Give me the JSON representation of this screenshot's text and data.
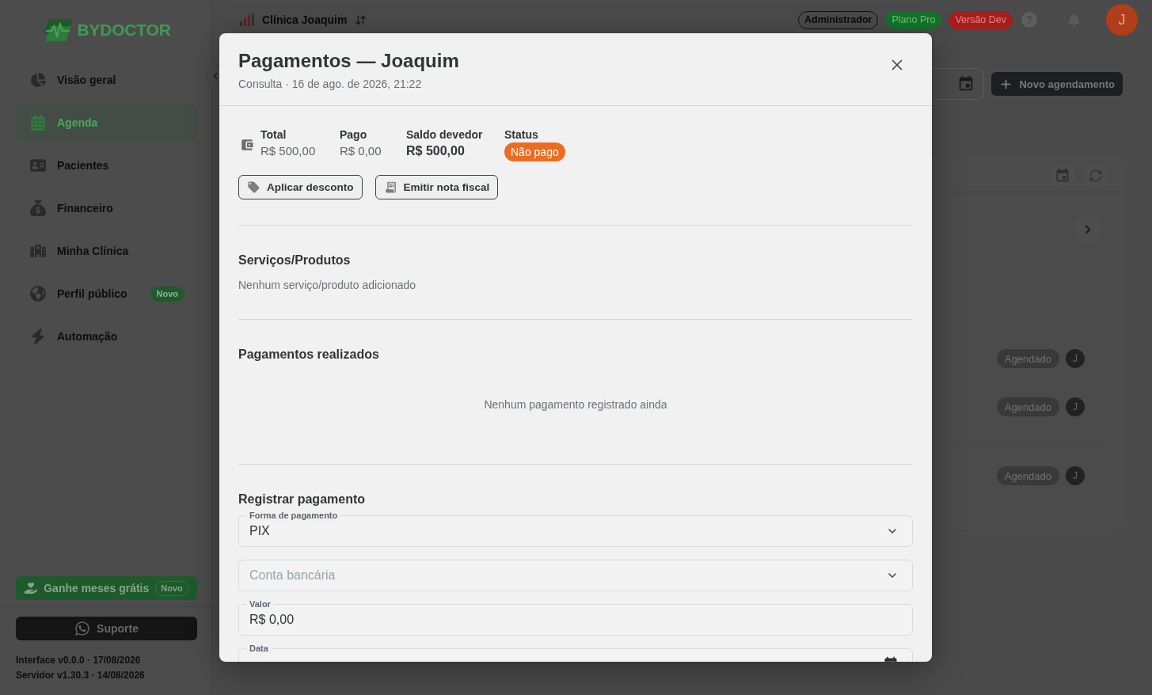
{
  "sidebar": {
    "logo": "BYDOCTOR",
    "items": [
      {
        "label": "Visão geral",
        "selected": false
      },
      {
        "label": "Agenda",
        "selected": true
      },
      {
        "label": "Pacientes",
        "selected": false
      },
      {
        "label": "Financeiro",
        "selected": false
      },
      {
        "label": "Minha Clínica",
        "selected": false
      },
      {
        "label": "Perfil público",
        "selected": false,
        "badge": "Novo"
      },
      {
        "label": "Automação",
        "selected": false
      }
    ],
    "promo": {
      "label": "Ganhe meses grátis",
      "badge": "Novo"
    },
    "support": "Suporte",
    "versions": [
      "Interface v0.0.0 · 17/08/2026",
      "Servidor v1.30.3 · 14/08/2026"
    ]
  },
  "header": {
    "clinic": "Clínica Joaquim",
    "badges": [
      {
        "label": "Administrador",
        "kind": "role"
      },
      {
        "label": "Plano Pro",
        "kind": "plan"
      },
      {
        "label": "Versão Dev",
        "kind": "env"
      }
    ],
    "avatar": "J"
  },
  "toolbar": {
    "new_appointment": "Novo agendamento"
  },
  "appointments": [
    {
      "status": "Agendado",
      "avatar": "J"
    },
    {
      "status": "Agendado",
      "avatar": "J"
    },
    {
      "status": "Agendado",
      "avatar": "J"
    }
  ],
  "modal": {
    "title": "Pagamentos — Joaquim",
    "subtitle": "Consulta · 16 de ago. de 2026, 21:22",
    "summary": [
      {
        "label": "Total",
        "value": "R$ 500,00",
        "kind": "amount"
      },
      {
        "label": "Pago",
        "value": "R$ 0,00",
        "kind": "amount"
      },
      {
        "label": "Saldo devedor",
        "value": "R$ 500,00",
        "kind": "balance"
      },
      {
        "label": "Status",
        "value": "Não pago",
        "kind": "status"
      }
    ],
    "actions": [
      "Aplicar desconto",
      "Emitir nota fiscal"
    ],
    "services": {
      "title": "Serviços/Produtos",
      "empty": "Nenhum serviço/produto adicionado"
    },
    "payments": {
      "title": "Pagamentos realizados",
      "empty": "Nenhum pagamento registrado ainda"
    },
    "register": {
      "title": "Registrar pagamento",
      "fields": [
        {
          "kind": "select",
          "label": "Forma de pagamento",
          "value": "PIX"
        },
        {
          "kind": "select",
          "placeholder": "Conta bancária"
        },
        {
          "kind": "text",
          "label": "Valor",
          "value": "R$ 0,00"
        },
        {
          "kind": "date",
          "label": "Data"
        }
      ]
    }
  }
}
